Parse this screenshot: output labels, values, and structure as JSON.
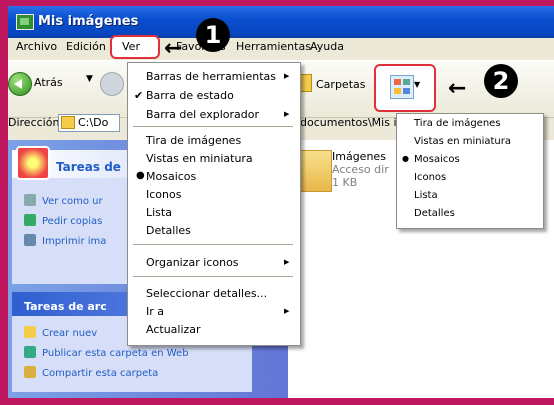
{
  "window": {
    "title": "Mis imágenes"
  },
  "menubar": [
    "Archivo",
    "Edición",
    "Ver",
    "Favoritos",
    "Herramientas",
    "Ayuda"
  ],
  "toolbar": {
    "back": "Atrás",
    "folders": "Carpetas"
  },
  "address": {
    "label": "Dirección",
    "short": "C:\\Do",
    "path": "documentos\\Mis ir"
  },
  "badges": {
    "one": "1",
    "two": "2"
  },
  "ver_menu": {
    "items": [
      "Barras de herramientas",
      "Barra de estado",
      "Barra del explorador",
      "Tira de imágenes",
      "Vistas en miniatura",
      "Mosaicos",
      "Iconos",
      "Lista",
      "Detalles",
      "Organizar iconos",
      "Seleccionar detalles...",
      "Ir a",
      "Actualizar"
    ]
  },
  "views_menu": {
    "items": [
      "Tira de imágenes",
      "Vistas en miniatura",
      "Mosaicos",
      "Iconos",
      "Lista",
      "Detalles"
    ]
  },
  "tasks": {
    "panel1_title": "Tareas de",
    "panel1_links": [
      "Ver como ur",
      "Pedir copias",
      "Imprimir ima"
    ],
    "panel2_title": "Tareas de arc",
    "panel2_links": [
      "Crear nuev",
      "Publicar esta carpeta en Web",
      "Compartir esta carpeta"
    ]
  },
  "content": {
    "name": "Imágenes",
    "sub": "Acceso dir",
    "size": "1 KB"
  }
}
